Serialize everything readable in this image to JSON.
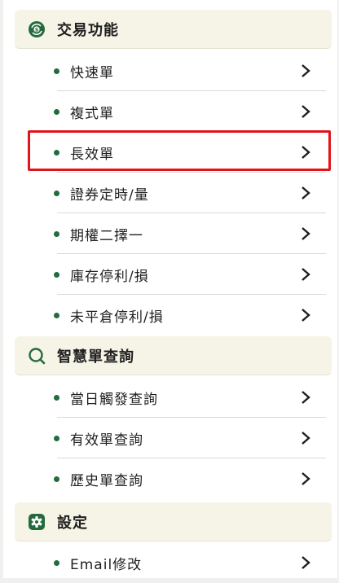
{
  "sections": [
    {
      "label": "交易功能",
      "icon": "exchange-coin-icon",
      "items": [
        "快速單",
        "複式單",
        "長效單",
        "證券定時/量",
        "期權二擇一",
        "庫存停利/損",
        "未平倉停利/損"
      ]
    },
    {
      "label": "智慧單查詢",
      "icon": "search-icon",
      "items": [
        "當日觸發查詢",
        "有效單查詢",
        "歷史單查詢"
      ]
    },
    {
      "label": "設定",
      "icon": "gear-icon",
      "items": [
        "Email修改"
      ]
    }
  ],
  "highlighted_item": "長效單",
  "colors": {
    "accent_green": "#236b3c",
    "header_bg": "#f6f4e7",
    "highlight_red": "#e2141b"
  }
}
